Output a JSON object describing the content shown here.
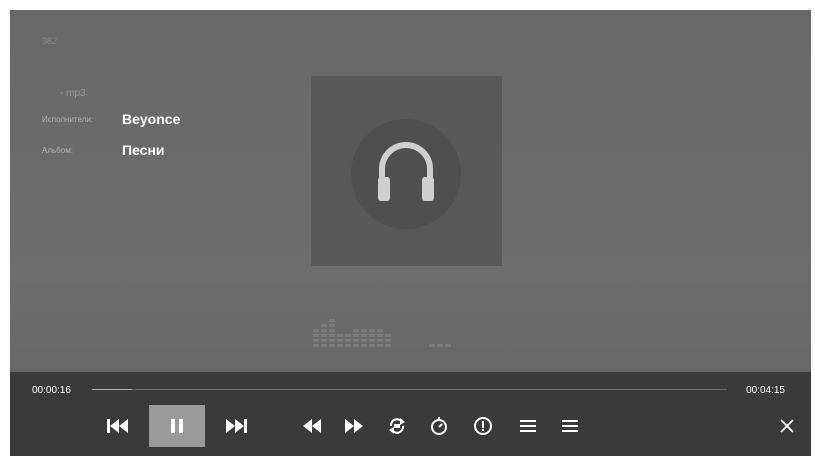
{
  "top_label": "982",
  "meta": {
    "format": "-   mp3",
    "artist_key": "Исполнители:",
    "artist_value": "Beyonce",
    "album_key": "Альбом:",
    "album_value": "Песни"
  },
  "playback": {
    "current_time": "00:00:16",
    "duration": "00:04:15",
    "progress": 0.063
  },
  "controls": [
    "previous-track-icon",
    "pause-icon",
    "next-track-icon",
    "rewind-icon",
    "fast-forward-icon",
    "repeat-all-icon",
    "sleep-timer-icon",
    "info-icon",
    "playlist-icon",
    "menu-icon",
    "close-icon"
  ],
  "colors": {
    "background": "#686868",
    "control_bar": "#3a3a3a",
    "highlight": "#9a9a9a"
  }
}
